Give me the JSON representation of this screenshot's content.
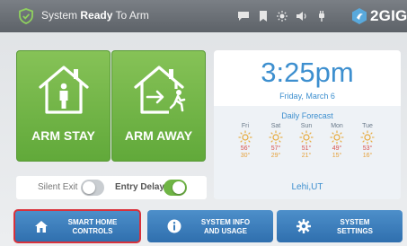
{
  "status_bar": {
    "state": "Ready",
    "prefix": "System",
    "suffix": "To Arm",
    "brand": "2GIG",
    "icons": [
      "shield-check-icon",
      "message-icon",
      "bookmark-icon",
      "brightness-icon",
      "volume-icon",
      "plug-icon",
      "brand-logo-icon"
    ]
  },
  "arm_tiles": [
    {
      "label": "ARM STAY",
      "icon": "home-person-icon"
    },
    {
      "label": "ARM AWAY",
      "icon": "home-exit-icon"
    }
  ],
  "toggles": {
    "silent_exit": {
      "label": "Silent Exit",
      "on": false
    },
    "entry_delay": {
      "label": "Entry Delay",
      "on": true
    }
  },
  "clock": {
    "time": "3:25pm",
    "date": "Friday, March 6"
  },
  "forecast": {
    "title": "Daily Forecast",
    "days": [
      {
        "name": "Fri",
        "high": "56°",
        "low": "30°",
        "icon": "sun-icon"
      },
      {
        "name": "Sat",
        "high": "57°",
        "low": "29°",
        "icon": "sun-icon"
      },
      {
        "name": "Sun",
        "high": "51°",
        "low": "21°",
        "icon": "sun-icon"
      },
      {
        "name": "Mon",
        "high": "49°",
        "low": "15°",
        "icon": "sun-icon"
      },
      {
        "name": "Tue",
        "high": "53°",
        "low": "16°",
        "icon": "sun-icon"
      }
    ],
    "location": "Lehi,UT"
  },
  "bottom_buttons": [
    {
      "line1": "SMART HOME",
      "line2": "CONTROLS",
      "icon": "home-icon",
      "selected": true
    },
    {
      "line1": "SYSTEM INFO",
      "line2": "AND USAGE",
      "icon": "info-icon",
      "selected": false
    },
    {
      "line1": "SYSTEM",
      "line2": "SETTINGS",
      "icon": "gear-icon",
      "selected": false
    }
  ],
  "colors": {
    "accent_green": "#6fb545",
    "accent_blue": "#3d8fcf",
    "button_blue": "#3a7dbd",
    "selection_red": "#d8313b"
  }
}
